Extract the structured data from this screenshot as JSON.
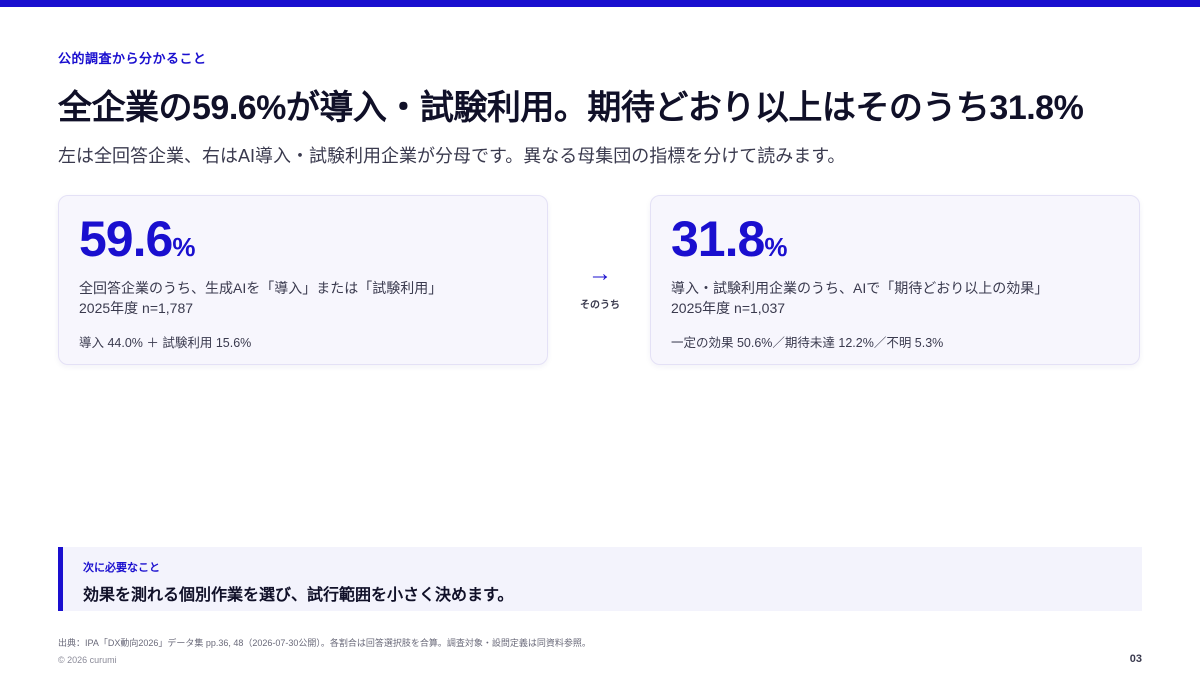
{
  "colors": {
    "accent": "#1a0fcf",
    "text": "#101028",
    "card_bg": "#f7f6fd"
  },
  "eyebrow": "公的調査から分かること",
  "title": "全企業の59.6%が導入・試験利用。期待どおり以上はそのうち31.8%",
  "subtitle": "左は全回答企業、右はAI導入・試験利用企業が分母です。異なる母集団の指標を分けて読みます。",
  "cards": [
    {
      "value": "59.6",
      "unit": "%",
      "desc": "全回答企業のうち、生成AIを「導入」または「試験利用」",
      "sample": "2025年度 n=1,787",
      "detail": "導入 44.0% ＋ 試験利用 15.6%"
    },
    {
      "value": "31.8",
      "unit": "%",
      "desc": "導入・試験利用企業のうち、AIで「期待どおり以上の効果」",
      "sample": "2025年度 n=1,037",
      "detail": "一定の効果 50.6%／期待未達 12.2%／不明 5.3%"
    }
  ],
  "connector": {
    "icon": "arrow-right-icon",
    "arrow": "→",
    "label": "そのうち"
  },
  "callout": {
    "label": "次に必要なこと",
    "text": "効果を測れる個別作業を選び、試行範囲を小さく決めます。"
  },
  "source": "出典：IPA「DX動向2026」データ集 pp.36, 48（2026-07-30公開）。各割合は回答選択肢を合算。調査対象・設問定義は同資料参照。",
  "copyright": "© 2026 curumi",
  "page_number": "03"
}
